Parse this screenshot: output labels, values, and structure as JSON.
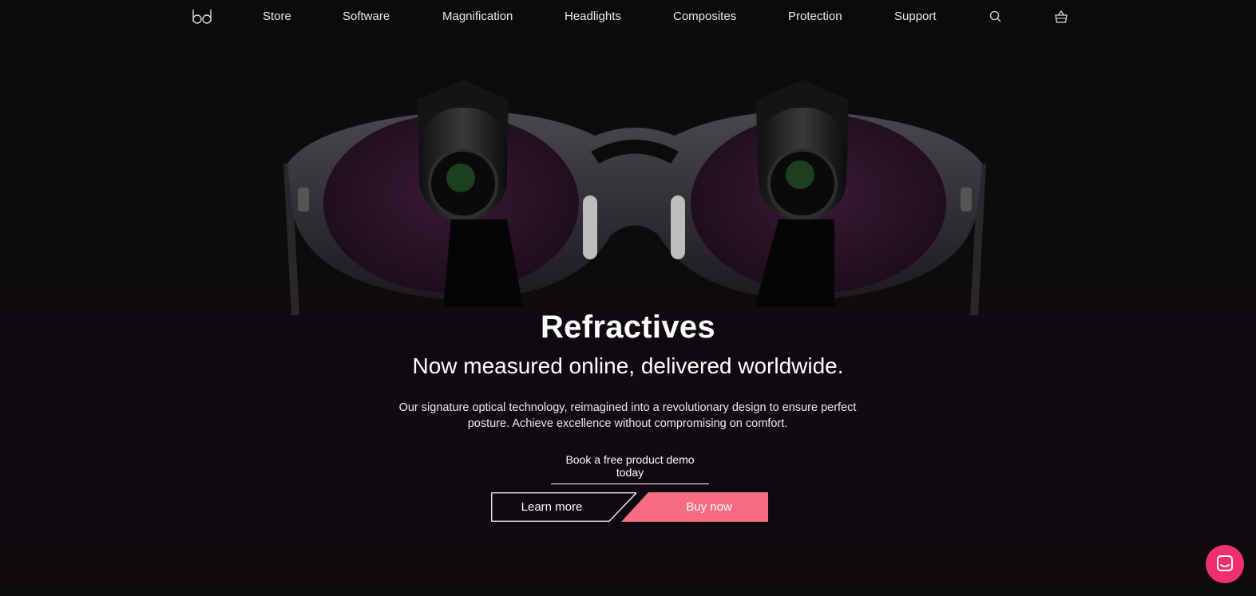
{
  "nav": {
    "logo_text": "bd",
    "items": [
      {
        "label": "Store"
      },
      {
        "label": "Software"
      },
      {
        "label": "Magnification"
      },
      {
        "label": "Headlights"
      },
      {
        "label": "Composites"
      },
      {
        "label": "Protection"
      },
      {
        "label": "Support"
      }
    ],
    "search_icon": "search-icon",
    "cart_icon": "basket-icon"
  },
  "hero": {
    "image_alt_brand": "Refractives",
    "title": "Refractives",
    "subtitle": "Now measured online, delivered worldwide.",
    "description": "Our signature optical technology, reimagined into a revolutionary design to ensure perfect posture. Achieve excellence without compromising on comfort.",
    "demo_link": "Book a free product demo today",
    "learn_more": "Learn more",
    "buy_now": "Buy now"
  },
  "colors": {
    "accent": "#f76c82",
    "chat": "#f0306e",
    "background": "#0c0b0c"
  },
  "chat_icon": "chat-icon"
}
